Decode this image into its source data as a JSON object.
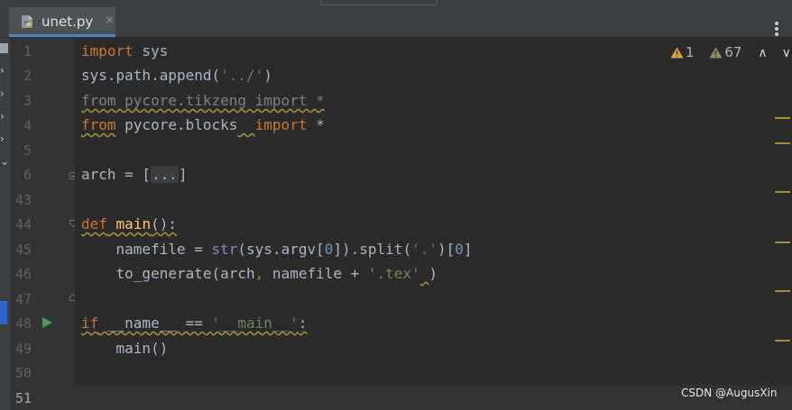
{
  "tab": {
    "filename": "unet.py",
    "close": "×"
  },
  "gutter": {
    "line_numbers": [
      "1",
      "2",
      "3",
      "4",
      "5",
      "6",
      "43",
      "44",
      "45",
      "46",
      "47",
      "48",
      "49",
      "50",
      "51"
    ]
  },
  "code": {
    "l1_kw": "import",
    "l1_rest": " sys",
    "l2_a": "sys.path.append(",
    "l2_str": "'../'",
    "l2_b": ")",
    "l3": "from pycore.tikzeng import *",
    "l4_from": "from",
    "l4_mid": " pycore.blocks",
    "l4_sp": "  ",
    "l4_import": "import",
    "l4_rest": " *",
    "l6_a": "arch = [",
    "l6_ellipsis": "...",
    "l6_b": "]",
    "l44_def": "def",
    "l44_sp": " ",
    "l44_fn": "main",
    "l44_rest": "():",
    "l45_a": "    namefile = ",
    "l45_str": "str",
    "l45_b": "(sys.argv[",
    "l45_n0": "0",
    "l45_c": "]).split(",
    "l45_dot": "'.'",
    "l45_d": ")[",
    "l45_n1": "0",
    "l45_e": "]",
    "l46_a": "    to_generate(arch",
    "l46_comma": ",",
    "l46_b": " namefile + ",
    "l46_str": "'.tex'",
    "l46_sp": " ",
    "l46_c": ")",
    "l48_if": "if",
    "l48_a": " __name__ == ",
    "l48_str": "'__main__'",
    "l48_b": ":",
    "l49": "    main()"
  },
  "inspections": {
    "errors": "1",
    "warnings": "67",
    "up": "∧",
    "down": "∨"
  },
  "watermark": "CSDN @AugusXin",
  "colors": {
    "keyword": "#cc7832",
    "function": "#ffc66d",
    "string": "#6a8759",
    "number": "#6897bb",
    "comment_gray": "#808080",
    "text": "#a9b7c6",
    "run": "#499c54",
    "tab_underline": "#4a88c7"
  },
  "icons": [
    "python-file-icon",
    "close-icon",
    "more-options-icon",
    "run-icon",
    "warning-icon",
    "chevron-up-icon",
    "chevron-down-icon",
    "fold-icon"
  ]
}
